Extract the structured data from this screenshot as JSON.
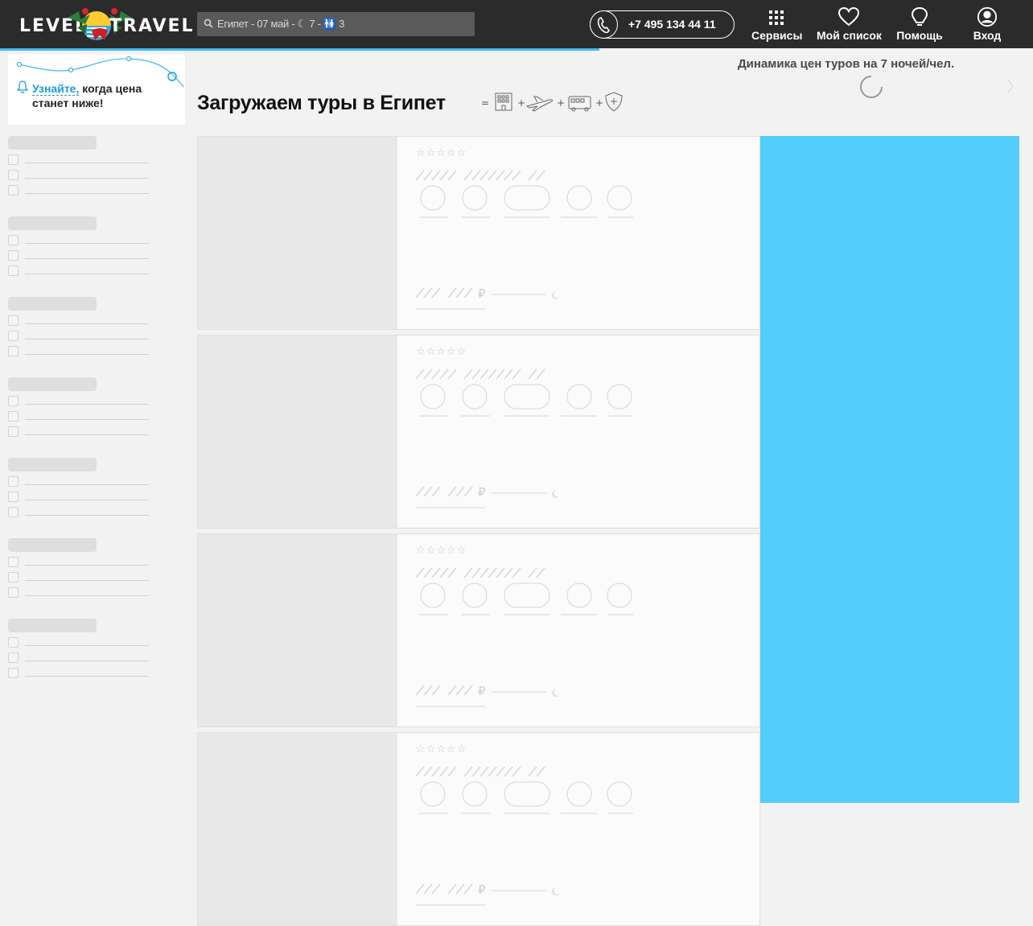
{
  "header": {
    "logo_left": "LEVEL",
    "logo_right": "TRAVEL",
    "search_text": "Египет - 07 май - ☾ 7 - 🚻 3",
    "phone": "+7 495 134 44 11",
    "nav": [
      {
        "label": "Сервисы",
        "icon": "grid-icon"
      },
      {
        "label": "Мой список",
        "icon": "heart-icon"
      },
      {
        "label": "Помощь",
        "icon": "help-bulb-icon"
      },
      {
        "label": "Вход",
        "icon": "user-icon"
      }
    ],
    "loading_progress_percent": 58
  },
  "subscribe": {
    "link": "Узнайте,",
    "text_rest": " когда цена станет ниже!"
  },
  "main": {
    "title": "Загружаем туры в Египет",
    "price_dynamics_title": "Динамика цен туров на 7 ночей/чел.",
    "package_icons": [
      "hotel-icon",
      "plane-icon",
      "bus-icon",
      "insurance-icon"
    ]
  },
  "colors": {
    "header_bg": "#2b2b2b",
    "accent": "#40b8f4",
    "link": "#1a9be0",
    "map_bg": "#53cdfc"
  }
}
